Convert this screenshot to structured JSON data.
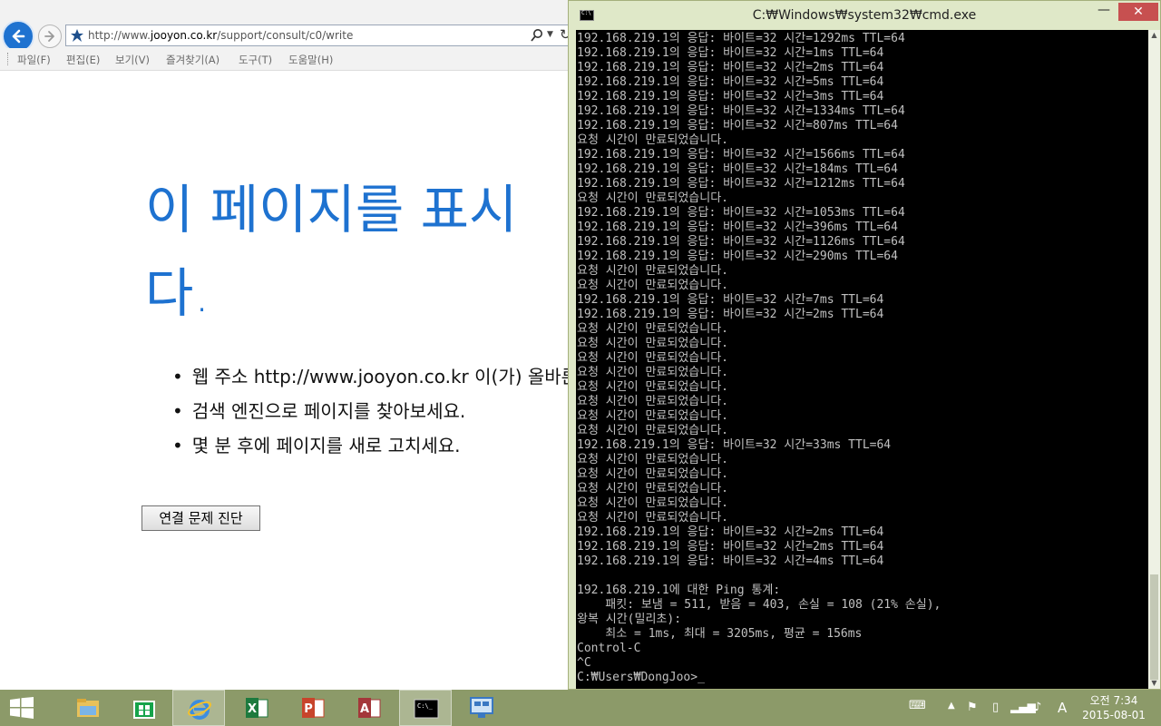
{
  "browser": {
    "url_prefix": "http://www.",
    "url_host": "jooyon.co.kr",
    "url_path": "/support/consult/c0/write",
    "menu": [
      "파일(F)",
      "편집(E)",
      "보기(V)",
      "즐겨찾기(A)",
      "도구(T)",
      "도움말(H)"
    ],
    "error_title_line1": "이 페이지를 표시",
    "error_title_line2": "다.",
    "suggestions": [
      "웹 주소 http://www.jooyon.co.kr 이(가) 올바른지 확인하세요.",
      "검색 엔진으로 페이지를 찾아보세요.",
      "몇 분 후에 페이지를 새로 고치세요."
    ],
    "diagnose_button": "연결 문제 진단",
    "accent_color": "#1e72d0"
  },
  "cmd": {
    "title": "C:₩Windows₩system32₩cmd.exe",
    "minimize": "—",
    "close": "✕",
    "lines": [
      "192.168.219.1의 응답: 바이트=32 시간=1292ms TTL=64",
      "192.168.219.1의 응답: 바이트=32 시간=1ms TTL=64",
      "192.168.219.1의 응답: 바이트=32 시간=2ms TTL=64",
      "192.168.219.1의 응답: 바이트=32 시간=5ms TTL=64",
      "192.168.219.1의 응답: 바이트=32 시간=3ms TTL=64",
      "192.168.219.1의 응답: 바이트=32 시간=1334ms TTL=64",
      "192.168.219.1의 응답: 바이트=32 시간=807ms TTL=64",
      "요청 시간이 만료되었습니다.",
      "192.168.219.1의 응답: 바이트=32 시간=1566ms TTL=64",
      "192.168.219.1의 응답: 바이트=32 시간=184ms TTL=64",
      "192.168.219.1의 응답: 바이트=32 시간=1212ms TTL=64",
      "요청 시간이 만료되었습니다.",
      "192.168.219.1의 응답: 바이트=32 시간=1053ms TTL=64",
      "192.168.219.1의 응답: 바이트=32 시간=396ms TTL=64",
      "192.168.219.1의 응답: 바이트=32 시간=1126ms TTL=64",
      "192.168.219.1의 응답: 바이트=32 시간=290ms TTL=64",
      "요청 시간이 만료되었습니다.",
      "요청 시간이 만료되었습니다.",
      "192.168.219.1의 응답: 바이트=32 시간=7ms TTL=64",
      "192.168.219.1의 응답: 바이트=32 시간=2ms TTL=64",
      "요청 시간이 만료되었습니다.",
      "요청 시간이 만료되었습니다.",
      "요청 시간이 만료되었습니다.",
      "요청 시간이 만료되었습니다.",
      "요청 시간이 만료되었습니다.",
      "요청 시간이 만료되었습니다.",
      "요청 시간이 만료되었습니다.",
      "요청 시간이 만료되었습니다.",
      "192.168.219.1의 응답: 바이트=32 시간=33ms TTL=64",
      "요청 시간이 만료되었습니다.",
      "요청 시간이 만료되었습니다.",
      "요청 시간이 만료되었습니다.",
      "요청 시간이 만료되었습니다.",
      "요청 시간이 만료되었습니다.",
      "192.168.219.1의 응답: 바이트=32 시간=2ms TTL=64",
      "192.168.219.1의 응답: 바이트=32 시간=2ms TTL=64",
      "192.168.219.1의 응답: 바이트=32 시간=4ms TTL=64",
      "",
      "192.168.219.1에 대한 Ping 통계:",
      "    패킷: 보냄 = 511, 받음 = 403, 손실 = 108 (21% 손실),",
      "왕복 시간(밀리초):",
      "    최소 = 1ms, 최대 = 3205ms, 평균 = 156ms",
      "Control-C",
      "^C",
      "C:₩Users₩DongJoo>"
    ]
  },
  "taskbar": {
    "apps": [
      "file-explorer-icon",
      "store-icon",
      "internet-explorer-icon",
      "excel-icon",
      "powerpoint-icon",
      "access-icon",
      "cmd-icon",
      "remote-desktop-icon"
    ],
    "clock_time": "오전 7:34",
    "clock_date": "2015-08-01",
    "ime_label": "A",
    "color": "#8c9a69"
  }
}
